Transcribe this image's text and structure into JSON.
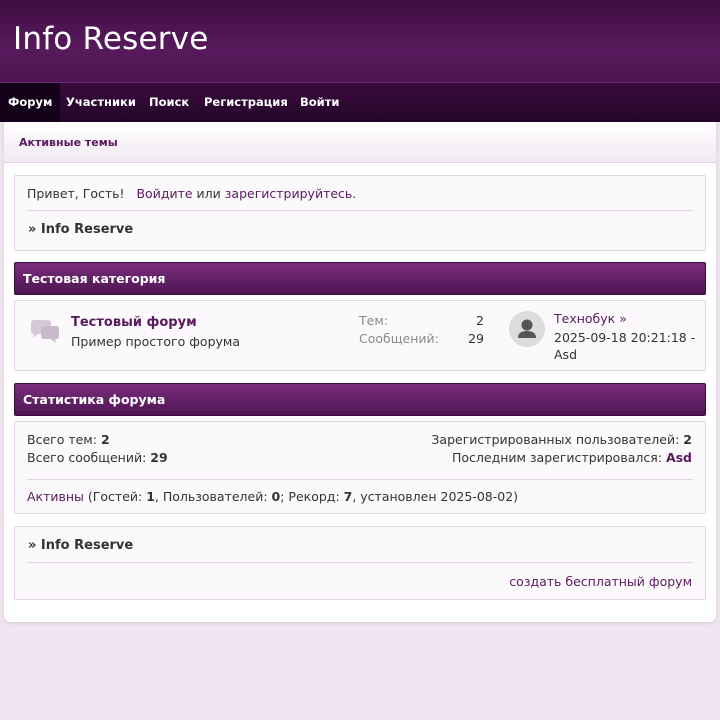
{
  "header": {
    "title": "Info Reserve"
  },
  "nav": {
    "items": [
      {
        "label": "Форум",
        "active": true
      },
      {
        "label": "Участники"
      },
      {
        "label": "Поиск"
      },
      {
        "label": "Регистрация"
      },
      {
        "label": "Войти"
      }
    ]
  },
  "subnav": {
    "active_topics": "Активные темы"
  },
  "welcome": {
    "greeting": "Привет, Гость!",
    "login_link": "Войдите",
    "or": "или",
    "register_link": "зарегистрируйтесь",
    "period": ".",
    "breadcrumb": "» Info Reserve"
  },
  "category": {
    "title": "Тестовая категория",
    "forum": {
      "name": "Тестовый форум",
      "description": "Пример простого форума",
      "topics_label": "Тем:",
      "topics_value": "2",
      "posts_label": "Сообщений:",
      "posts_value": "29",
      "last_post_user": "Технобук",
      "last_post_arrow": "»",
      "last_post_date": "2025-09-18 20:21:18 - Asd"
    }
  },
  "stats": {
    "title": "Статистика форума",
    "total_topics_label": "Всего тем:",
    "total_topics_value": "2",
    "total_posts_label": "Всего сообщений:",
    "total_posts_value": "29",
    "registered_users_label": "Зарегистрированных пользователей:",
    "registered_users_value": "2",
    "last_registered_label": "Последним зарегистрировался:",
    "last_registered_value": "Asd",
    "online_link": "Активны",
    "online_guests_label": " (Гостей: ",
    "online_guests_value": "1",
    "online_users_label": ", Пользователей: ",
    "online_users_value": "0",
    "online_record_label": "; Рекорд: ",
    "online_record_value": "7",
    "online_record_date": ", установлен 2025-08-02)"
  },
  "footer": {
    "breadcrumb": "» Info Reserve",
    "free_forum": "создать бесплатный форум"
  },
  "colors": {
    "header_bg": "#4e1552",
    "accent": "#5a1a5e",
    "page_bg": "#efe4f0"
  },
  "icons": {
    "forum": "speech-bubbles-icon",
    "avatar": "user-silhouette-icon"
  }
}
